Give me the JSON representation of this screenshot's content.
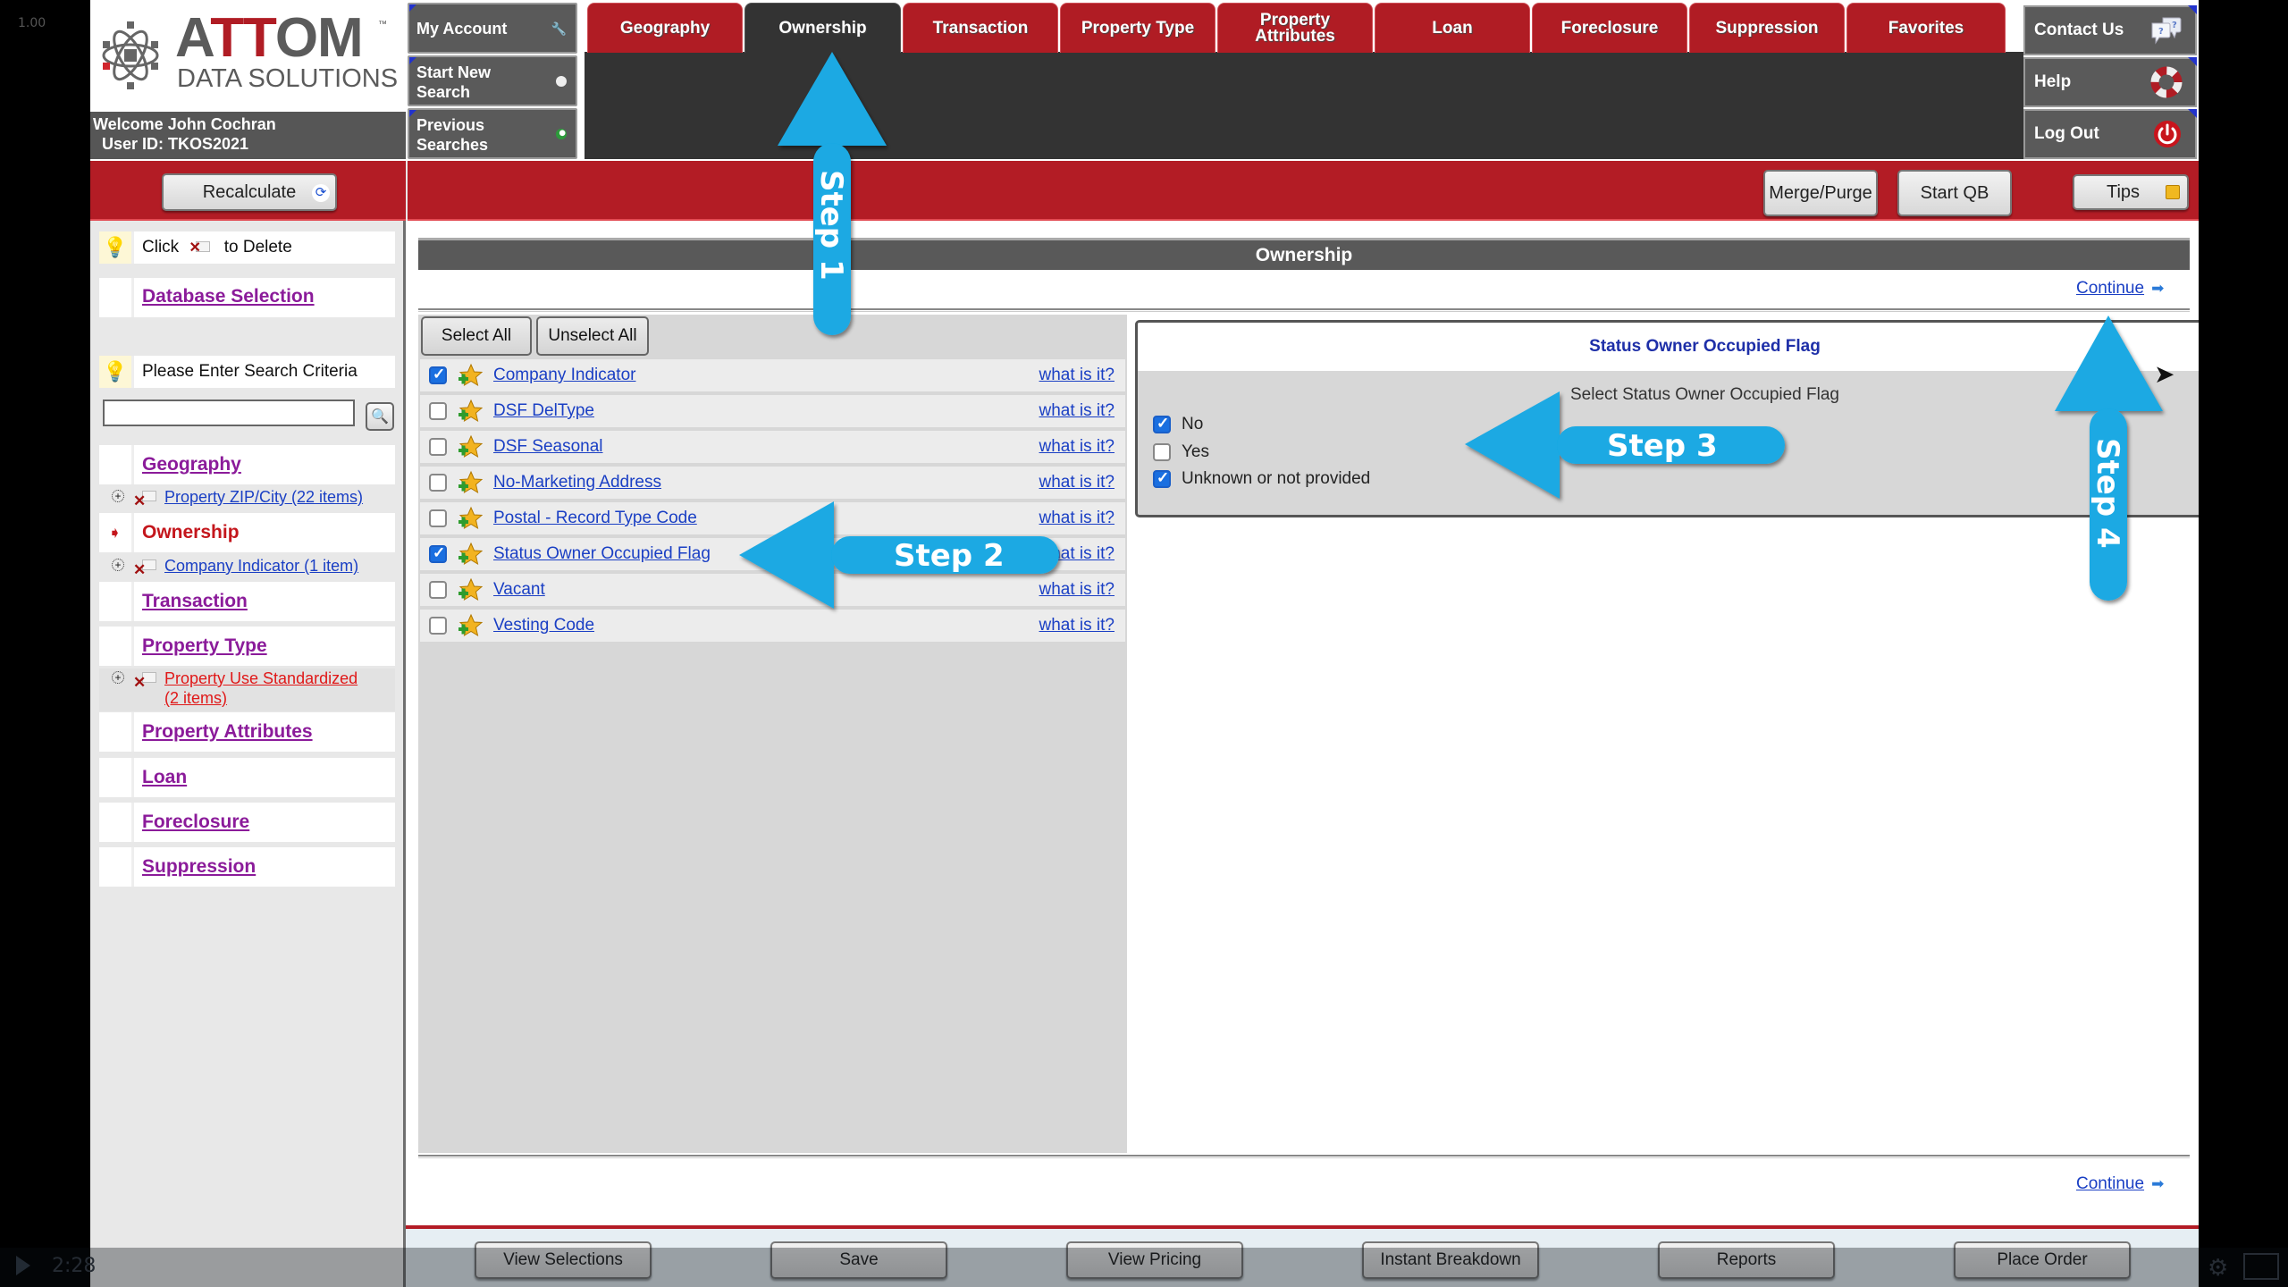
{
  "video": {
    "speed": "1.00",
    "time": "2:28"
  },
  "brand": {
    "name_part1": "A",
    "name_part2": "TT",
    "name_part3": "OM",
    "trademark": "™",
    "subtitle": "DATA SOLUTIONS"
  },
  "user": {
    "welcome": "Welcome John Cochran",
    "user_id": "User ID: TKOS2021"
  },
  "account_menu": [
    {
      "label": "My Account",
      "icon": "wrench-icon"
    },
    {
      "label": "Start New Search",
      "icon": "magnifier-icon"
    },
    {
      "label": "Previous Searches",
      "icon": "globe-icon"
    }
  ],
  "tabs": [
    {
      "label": "Geography",
      "active": false
    },
    {
      "label": "Ownership",
      "active": true
    },
    {
      "label": "Transaction",
      "active": false
    },
    {
      "label": "Property Type",
      "active": false
    },
    {
      "label": "Property Attributes",
      "active": false
    },
    {
      "label": "Loan",
      "active": false
    },
    {
      "label": "Foreclosure",
      "active": false
    },
    {
      "label": "Suppression",
      "active": false
    },
    {
      "label": "Favorites",
      "active": false
    }
  ],
  "right_menu": [
    {
      "label": "Contact Us",
      "icon": "chat-bubbles-icon"
    },
    {
      "label": "Help",
      "icon": "lifebuoy-icon"
    },
    {
      "label": "Log Out",
      "icon": "power-icon"
    }
  ],
  "toolbar": {
    "recalculate": "Recalculate",
    "merge_purge": "Merge/Purge",
    "start_qb": "Start QB",
    "tips": "Tips"
  },
  "sidebar": {
    "hint_click": "Click",
    "hint_delete": "to Delete",
    "database_selection": "Database Selection",
    "search_hint": "Please Enter Search Criteria",
    "search_value": "",
    "sections": [
      {
        "label": "Geography",
        "current": false
      },
      {
        "label": "Ownership",
        "current": true
      },
      {
        "label": "Transaction",
        "current": false
      },
      {
        "label": "Property Type",
        "current": false
      },
      {
        "label": "Property Attributes",
        "current": false
      },
      {
        "label": "Loan",
        "current": false
      },
      {
        "label": "Foreclosure",
        "current": false
      },
      {
        "label": "Suppression",
        "current": false
      }
    ],
    "criteria": {
      "geography": "Property ZIP/City (22 items)",
      "ownership": "Company Indicator (1 item)",
      "property_type_line1": "Property Use Standardized",
      "property_type_line2": "(2 items)"
    }
  },
  "main": {
    "section_title": "Ownership",
    "continue": "Continue",
    "select_all": "Select All",
    "unselect_all": "Unselect All",
    "what_is_it": "what is it?",
    "fields": [
      {
        "name": "Company Indicator",
        "checked": true
      },
      {
        "name": "DSF DelType",
        "checked": false
      },
      {
        "name": "DSF Seasonal",
        "checked": false
      },
      {
        "name": "No-Marketing Address",
        "checked": false
      },
      {
        "name": "Postal - Record Type Code",
        "checked": false
      },
      {
        "name": "Status Owner Occupied Flag",
        "checked": true
      },
      {
        "name": "Vacant",
        "checked": false
      },
      {
        "name": "Vesting Code",
        "checked": false
      }
    ],
    "detail": {
      "title": "Status Owner Occupied Flag",
      "subtitle": "Select Status Owner Occupied Flag",
      "options": [
        {
          "label": "No",
          "checked": true
        },
        {
          "label": "Yes",
          "checked": false
        },
        {
          "label": "Unknown or not provided",
          "checked": true
        }
      ]
    }
  },
  "footer_buttons": [
    "View Selections",
    "Save",
    "View Pricing",
    "Instant Breakdown",
    "Reports",
    "Place Order"
  ],
  "annotations": {
    "color": "#1aa9e3",
    "steps": [
      "Step 1",
      "Step 2",
      "Step 3",
      "Step 4"
    ]
  },
  "colors": {
    "brand_red": "#b31c25",
    "dark_gray": "#333333",
    "link_blue": "#1a3fc4",
    "sidebar_purple": "#8b1b9a"
  }
}
